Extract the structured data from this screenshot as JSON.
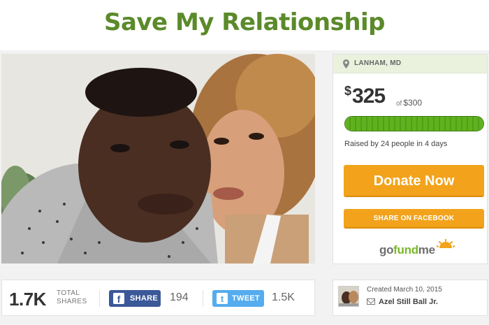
{
  "page": {
    "title": "Save My Relationship"
  },
  "photo": {
    "alt": "couple-photo"
  },
  "campaign": {
    "location": "LANHAM, MD",
    "currency_symbol": "$",
    "raised_amount": "325",
    "goal_prefix": "of",
    "goal_amount": "$300",
    "progress_fraction": 1.0,
    "raised_text": "Raised by 24 people in 4 days",
    "donate_label": "Donate Now",
    "share_facebook_label": "SHARE ON FACEBOOK",
    "logo": {
      "go": "go",
      "fund": "fund",
      "me": "me"
    }
  },
  "shares": {
    "total_count": "1.7K",
    "total_label_line1": "TOTAL",
    "total_label_line2": "SHARES",
    "facebook_label": "SHARE",
    "facebook_count": "194",
    "twitter_label": "TWEET",
    "twitter_count": "1.5K"
  },
  "creator": {
    "created_text": "Created March 10, 2015",
    "organizer_name": "Azel Still Ball Jr."
  },
  "colors": {
    "title_green": "#5b8a2a",
    "progress_green": "#5fb21e",
    "donate_orange": "#f2a31b",
    "facebook_blue": "#3b5898",
    "twitter_blue": "#55acee"
  },
  "icons": {
    "location": "map-pin-icon",
    "mail": "mail-icon",
    "facebook": "facebook-icon",
    "twitter": "twitter-icon"
  }
}
